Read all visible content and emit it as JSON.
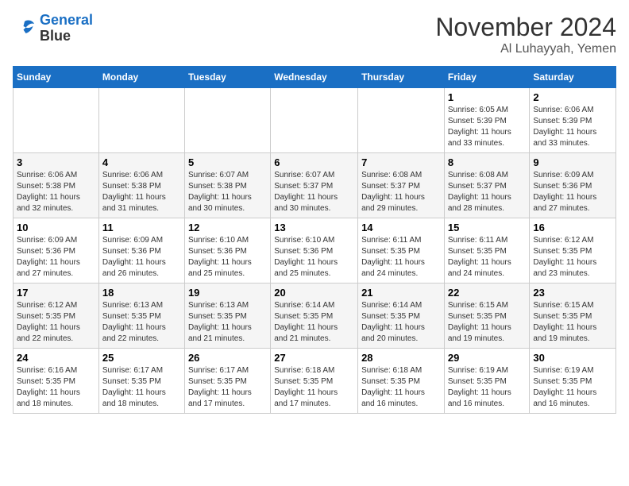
{
  "logo": {
    "line1": "General",
    "line2": "Blue"
  },
  "title": "November 2024",
  "location": "Al Luhayyah, Yemen",
  "days_header": [
    "Sunday",
    "Monday",
    "Tuesday",
    "Wednesday",
    "Thursday",
    "Friday",
    "Saturday"
  ],
  "weeks": [
    [
      {
        "day": "",
        "info": ""
      },
      {
        "day": "",
        "info": ""
      },
      {
        "day": "",
        "info": ""
      },
      {
        "day": "",
        "info": ""
      },
      {
        "day": "",
        "info": ""
      },
      {
        "day": "1",
        "info": "Sunrise: 6:05 AM\nSunset: 5:39 PM\nDaylight: 11 hours\nand 33 minutes."
      },
      {
        "day": "2",
        "info": "Sunrise: 6:06 AM\nSunset: 5:39 PM\nDaylight: 11 hours\nand 33 minutes."
      }
    ],
    [
      {
        "day": "3",
        "info": "Sunrise: 6:06 AM\nSunset: 5:38 PM\nDaylight: 11 hours\nand 32 minutes."
      },
      {
        "day": "4",
        "info": "Sunrise: 6:06 AM\nSunset: 5:38 PM\nDaylight: 11 hours\nand 31 minutes."
      },
      {
        "day": "5",
        "info": "Sunrise: 6:07 AM\nSunset: 5:38 PM\nDaylight: 11 hours\nand 30 minutes."
      },
      {
        "day": "6",
        "info": "Sunrise: 6:07 AM\nSunset: 5:37 PM\nDaylight: 11 hours\nand 30 minutes."
      },
      {
        "day": "7",
        "info": "Sunrise: 6:08 AM\nSunset: 5:37 PM\nDaylight: 11 hours\nand 29 minutes."
      },
      {
        "day": "8",
        "info": "Sunrise: 6:08 AM\nSunset: 5:37 PM\nDaylight: 11 hours\nand 28 minutes."
      },
      {
        "day": "9",
        "info": "Sunrise: 6:09 AM\nSunset: 5:36 PM\nDaylight: 11 hours\nand 27 minutes."
      }
    ],
    [
      {
        "day": "10",
        "info": "Sunrise: 6:09 AM\nSunset: 5:36 PM\nDaylight: 11 hours\nand 27 minutes."
      },
      {
        "day": "11",
        "info": "Sunrise: 6:09 AM\nSunset: 5:36 PM\nDaylight: 11 hours\nand 26 minutes."
      },
      {
        "day": "12",
        "info": "Sunrise: 6:10 AM\nSunset: 5:36 PM\nDaylight: 11 hours\nand 25 minutes."
      },
      {
        "day": "13",
        "info": "Sunrise: 6:10 AM\nSunset: 5:36 PM\nDaylight: 11 hours\nand 25 minutes."
      },
      {
        "day": "14",
        "info": "Sunrise: 6:11 AM\nSunset: 5:35 PM\nDaylight: 11 hours\nand 24 minutes."
      },
      {
        "day": "15",
        "info": "Sunrise: 6:11 AM\nSunset: 5:35 PM\nDaylight: 11 hours\nand 24 minutes."
      },
      {
        "day": "16",
        "info": "Sunrise: 6:12 AM\nSunset: 5:35 PM\nDaylight: 11 hours\nand 23 minutes."
      }
    ],
    [
      {
        "day": "17",
        "info": "Sunrise: 6:12 AM\nSunset: 5:35 PM\nDaylight: 11 hours\nand 22 minutes."
      },
      {
        "day": "18",
        "info": "Sunrise: 6:13 AM\nSunset: 5:35 PM\nDaylight: 11 hours\nand 22 minutes."
      },
      {
        "day": "19",
        "info": "Sunrise: 6:13 AM\nSunset: 5:35 PM\nDaylight: 11 hours\nand 21 minutes."
      },
      {
        "day": "20",
        "info": "Sunrise: 6:14 AM\nSunset: 5:35 PM\nDaylight: 11 hours\nand 21 minutes."
      },
      {
        "day": "21",
        "info": "Sunrise: 6:14 AM\nSunset: 5:35 PM\nDaylight: 11 hours\nand 20 minutes."
      },
      {
        "day": "22",
        "info": "Sunrise: 6:15 AM\nSunset: 5:35 PM\nDaylight: 11 hours\nand 19 minutes."
      },
      {
        "day": "23",
        "info": "Sunrise: 6:15 AM\nSunset: 5:35 PM\nDaylight: 11 hours\nand 19 minutes."
      }
    ],
    [
      {
        "day": "24",
        "info": "Sunrise: 6:16 AM\nSunset: 5:35 PM\nDaylight: 11 hours\nand 18 minutes."
      },
      {
        "day": "25",
        "info": "Sunrise: 6:17 AM\nSunset: 5:35 PM\nDaylight: 11 hours\nand 18 minutes."
      },
      {
        "day": "26",
        "info": "Sunrise: 6:17 AM\nSunset: 5:35 PM\nDaylight: 11 hours\nand 17 minutes."
      },
      {
        "day": "27",
        "info": "Sunrise: 6:18 AM\nSunset: 5:35 PM\nDaylight: 11 hours\nand 17 minutes."
      },
      {
        "day": "28",
        "info": "Sunrise: 6:18 AM\nSunset: 5:35 PM\nDaylight: 11 hours\nand 16 minutes."
      },
      {
        "day": "29",
        "info": "Sunrise: 6:19 AM\nSunset: 5:35 PM\nDaylight: 11 hours\nand 16 minutes."
      },
      {
        "day": "30",
        "info": "Sunrise: 6:19 AM\nSunset: 5:35 PM\nDaylight: 11 hours\nand 16 minutes."
      }
    ]
  ]
}
